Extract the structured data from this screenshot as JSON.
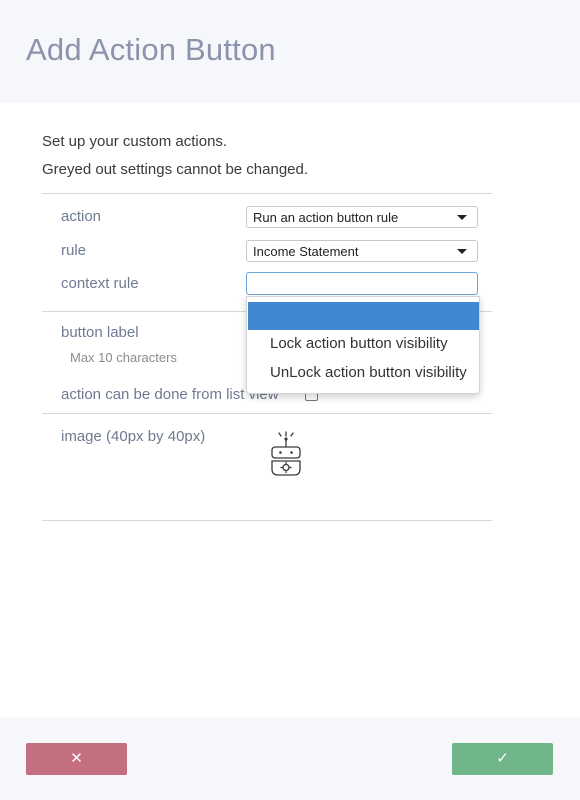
{
  "dialog": {
    "title": "Add Action Button",
    "intro_line1": "Set up your custom actions.",
    "intro_line2": "Greyed out settings cannot be changed."
  },
  "form": {
    "action_label": "action",
    "action_value": "Run an action button rule",
    "rule_label": "rule",
    "rule_value": "Income Statement",
    "context_rule_label": "context rule",
    "context_rule_value": "",
    "button_label_label": "button label",
    "button_label_hint": "Max 10 characters",
    "list_view_label": "action can be done from list view",
    "list_view_checked": false,
    "image_label": "image (40px by 40px)",
    "image_icon": "robot-icon"
  },
  "context_dropdown": {
    "selected_option": "",
    "options": [
      "Lock action button visibility",
      "UnLock action button visibility"
    ]
  },
  "footer": {
    "cancel_icon": "close-icon",
    "cancel_glyph": "✕",
    "confirm_icon": "check-icon",
    "confirm_glyph": "✓"
  },
  "colors": {
    "title": "#8b93ad",
    "label": "#6f7a93",
    "cancel_button": "#c46f80",
    "confirm_button": "#71b58a",
    "dropdown_highlight": "#4088cf",
    "input_focus_border": "#6aa6dc"
  }
}
